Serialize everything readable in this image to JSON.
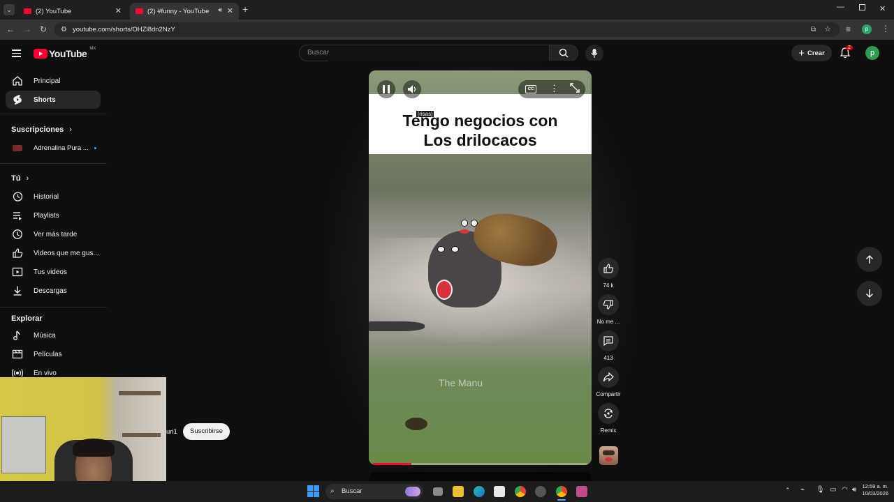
{
  "browser": {
    "tabs": [
      {
        "title": "(2) YouTube",
        "active": false
      },
      {
        "title": "(2) #funny - YouTube",
        "active": true
      }
    ],
    "url": "youtube.com/shorts/OHZl8dn2NzY"
  },
  "header": {
    "logo_text": "YouTube",
    "logo_region": "MX",
    "search_placeholder": "Buscar",
    "create_label": "Crear",
    "notif_count": "2",
    "avatar_letter": "p"
  },
  "sidebar": {
    "main": [
      {
        "label": "Principal",
        "icon": "home-icon"
      },
      {
        "label": "Shorts",
        "icon": "shorts-icon",
        "active": true
      }
    ],
    "subs_heading": "Suscripciones",
    "subs": [
      {
        "label": "Adrenalina Pura ..."
      }
    ],
    "you_heading": "Tú",
    "you": [
      {
        "label": "Historial",
        "icon": "history-icon"
      },
      {
        "label": "Playlists",
        "icon": "playlists-icon"
      },
      {
        "label": "Ver más tarde",
        "icon": "watch-later-icon"
      },
      {
        "label": "Videos que me gus...",
        "icon": "like-icon"
      },
      {
        "label": "Tus videos",
        "icon": "your-videos-icon"
      },
      {
        "label": "Descargas",
        "icon": "download-icon"
      }
    ],
    "explore_heading": "Explorar",
    "explore": [
      {
        "label": "Música",
        "icon": "music-icon"
      },
      {
        "label": "Películas",
        "icon": "movies-icon"
      },
      {
        "label": "En vivo",
        "icon": "live-icon"
      }
    ]
  },
  "video": {
    "caption_tag": "[risas]",
    "caption_line1": "Tengo negocios con",
    "caption_line2": "Los drilocacos",
    "watermark": "The Manu",
    "progress": 0.18,
    "channel_fragment": "uri1",
    "subscribe_label": "Suscribirse"
  },
  "actions": {
    "likes": "74 k",
    "dislike": "No me ...",
    "comments": "413",
    "share": "Compartir",
    "remix": "Remix"
  },
  "taskbar": {
    "search_label": "Buscar",
    "time": "12:59 a. m.",
    "date": "10/03/2026"
  }
}
